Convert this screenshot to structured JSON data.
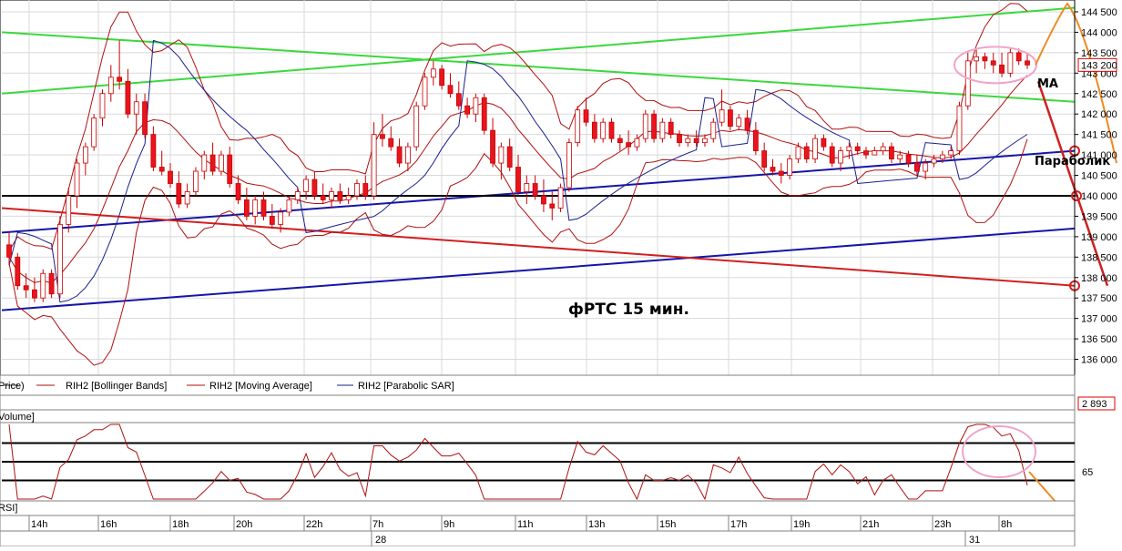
{
  "chart_data": {
    "type": "candlestick",
    "title": "фРТС   15 мин.",
    "symbol": "RIH2",
    "price_axis": {
      "ticks": [
        "144 500",
        "144 000",
        "143 500",
        "143 000",
        "142 500",
        "142 000",
        "141 500",
        "141 000",
        "140 500",
        "140 000",
        "139 500",
        "139 000",
        "138 500",
        "138 000",
        "137 500",
        "137 000",
        "136 500",
        "136 000"
      ],
      "values": [
        144500,
        144000,
        143500,
        143000,
        142500,
        142000,
        141500,
        141000,
        140500,
        140000,
        139500,
        139000,
        138500,
        138000,
        137500,
        137000,
        136500,
        136000
      ],
      "range": [
        135700,
        144700
      ],
      "last_price": "143 200"
    },
    "legend": {
      "price": "Price)",
      "bollinger": "RIH2 [Bollinger Bands]",
      "ma": "RIH2 [Moving Average]",
      "psar": "RIH2 [Parabolic SAR]"
    },
    "volume_panel": {
      "label": "Volume]",
      "value": "2 893"
    },
    "rsi_panel": {
      "label": "RSI]",
      "level_label": "65",
      "levels": [
        80,
        65,
        50
      ]
    },
    "time_axis": {
      "hour_labels": [
        "14h",
        "16h",
        "18h",
        "20h",
        "22h",
        "7h",
        "9h",
        "11h",
        "13h",
        "15h",
        "17h",
        "19h",
        "21h",
        "23h",
        "8h"
      ],
      "day_labels": [
        "28",
        "31"
      ]
    },
    "annotations": {
      "ma": "MA",
      "parabolic": "Параболик"
    },
    "candles": [
      [
        138800,
        139100,
        138300,
        138500
      ],
      [
        138500,
        138600,
        137700,
        137800
      ],
      [
        137800,
        138100,
        137500,
        137700
      ],
      [
        137700,
        138000,
        137400,
        137500
      ],
      [
        137500,
        138200,
        137400,
        138100
      ],
      [
        138100,
        138200,
        137500,
        137600
      ],
      [
        137600,
        139500,
        137500,
        139300
      ],
      [
        139300,
        140200,
        139100,
        140000
      ],
      [
        140000,
        140900,
        139700,
        140800
      ],
      [
        140800,
        141300,
        140500,
        141200
      ],
      [
        141200,
        142000,
        141100,
        141900
      ],
      [
        141900,
        142600,
        141700,
        142500
      ],
      [
        142500,
        143200,
        142300,
        142900
      ],
      [
        142900,
        143800,
        142600,
        142800
      ],
      [
        142800,
        143100,
        141900,
        142000
      ],
      [
        142000,
        142500,
        141500,
        142300
      ],
      [
        142300,
        142500,
        141400,
        141500
      ],
      [
        141500,
        141700,
        140600,
        140700
      ],
      [
        140700,
        141100,
        140500,
        140600
      ],
      [
        140600,
        140800,
        140200,
        140300
      ],
      [
        140300,
        140600,
        139700,
        139800
      ],
      [
        139800,
        140300,
        139700,
        140100
      ],
      [
        140100,
        140700,
        140000,
        140600
      ],
      [
        140600,
        141100,
        140400,
        141000
      ],
      [
        141000,
        141300,
        140500,
        140600
      ],
      [
        140600,
        141100,
        140500,
        141000
      ],
      [
        141000,
        141200,
        140200,
        140300
      ],
      [
        140300,
        140500,
        139800,
        139900
      ],
      [
        139900,
        140200,
        139400,
        139500
      ],
      [
        139500,
        140000,
        139300,
        139900
      ],
      [
        139900,
        140100,
        139400,
        139500
      ],
      [
        139500,
        139800,
        139200,
        139300
      ],
      [
        139300,
        139700,
        139100,
        139600
      ],
      [
        139600,
        140000,
        139500,
        139900
      ],
      [
        139900,
        140200,
        139800,
        140100
      ],
      [
        140100,
        140500,
        139900,
        140400
      ],
      [
        140400,
        140600,
        139900,
        140000
      ],
      [
        140000,
        140300,
        139800,
        139900
      ],
      [
        139900,
        140200,
        139700,
        140100
      ],
      [
        140100,
        140300,
        139800,
        139900
      ],
      [
        139900,
        140200,
        139800,
        140000
      ],
      [
        140000,
        140400,
        139900,
        140300
      ],
      [
        140300,
        140500,
        139900,
        140000
      ],
      [
        140000,
        141800,
        139900,
        141500
      ],
      [
        141500,
        142000,
        141200,
        141400
      ],
      [
        141400,
        141700,
        141100,
        141200
      ],
      [
        141200,
        141400,
        140700,
        140800
      ],
      [
        140800,
        141300,
        140600,
        141200
      ],
      [
        141200,
        142300,
        141100,
        142200
      ],
      [
        142200,
        143000,
        142100,
        142900
      ],
      [
        142900,
        143300,
        142700,
        143100
      ],
      [
        143100,
        143200,
        142600,
        142700
      ],
      [
        142700,
        143000,
        142400,
        142500
      ],
      [
        142500,
        142800,
        142100,
        142200
      ],
      [
        142200,
        142400,
        141900,
        142000
      ],
      [
        142000,
        142500,
        141800,
        142400
      ],
      [
        142400,
        142500,
        141500,
        141600
      ],
      [
        141600,
        141900,
        140700,
        140800
      ],
      [
        140800,
        141300,
        140400,
        141200
      ],
      [
        141200,
        141400,
        140600,
        140700
      ],
      [
        140700,
        141000,
        140000,
        140100
      ],
      [
        140100,
        140500,
        139800,
        140300
      ],
      [
        140300,
        140500,
        139900,
        140000
      ],
      [
        140000,
        140400,
        139600,
        139800
      ],
      [
        139800,
        140100,
        139400,
        139700
      ],
      [
        139700,
        140300,
        139600,
        140200
      ],
      [
        140200,
        141400,
        140100,
        141300
      ],
      [
        141300,
        142200,
        141200,
        142100
      ],
      [
        142100,
        142400,
        141700,
        141800
      ],
      [
        141800,
        142000,
        141300,
        141400
      ],
      [
        141400,
        141900,
        141300,
        141800
      ],
      [
        141800,
        141900,
        141300,
        141400
      ],
      [
        141400,
        141500,
        141100,
        141300
      ],
      [
        141300,
        141600,
        141000,
        141200
      ],
      [
        141200,
        141500,
        141100,
        141400
      ],
      [
        141400,
        142100,
        141300,
        142000
      ],
      [
        142000,
        142100,
        141300,
        141400
      ],
      [
        141400,
        141900,
        141300,
        141800
      ],
      [
        141800,
        141900,
        141400,
        141500
      ],
      [
        141500,
        141600,
        141200,
        141300
      ],
      [
        141300,
        141500,
        141200,
        141400
      ],
      [
        141400,
        141600,
        141200,
        141300
      ],
      [
        141300,
        141500,
        141200,
        141400
      ],
      [
        141400,
        141900,
        141300,
        141800
      ],
      [
        141800,
        142600,
        141700,
        142100
      ],
      [
        142100,
        142200,
        141600,
        141700
      ],
      [
        141700,
        142000,
        141600,
        141900
      ],
      [
        141900,
        142100,
        141500,
        141600
      ],
      [
        141600,
        141800,
        141000,
        141100
      ],
      [
        141100,
        141300,
        140600,
        140700
      ],
      [
        140700,
        140900,
        140500,
        140600
      ],
      [
        140600,
        140800,
        140300,
        140500
      ],
      [
        140500,
        141000,
        140400,
        140900
      ],
      [
        140900,
        141300,
        140800,
        141200
      ],
      [
        141200,
        141300,
        140800,
        140900
      ],
      [
        140900,
        141500,
        140800,
        141400
      ],
      [
        141400,
        141500,
        141100,
        141200
      ],
      [
        141200,
        141300,
        140700,
        140800
      ],
      [
        140800,
        141200,
        140600,
        141100
      ],
      [
        141100,
        141300,
        140900,
        141200
      ],
      [
        141200,
        141300,
        141000,
        141100
      ],
      [
        141100,
        141200,
        140900,
        141000
      ],
      [
        141000,
        141200,
        141000,
        141100
      ],
      [
        141100,
        141300,
        141000,
        141200
      ],
      [
        141200,
        141300,
        140800,
        140900
      ],
      [
        140900,
        141100,
        140800,
        141000
      ],
      [
        141000,
        141100,
        140700,
        140800
      ],
      [
        140800,
        141000,
        140500,
        140600
      ],
      [
        140600,
        140900,
        140400,
        140800
      ],
      [
        140800,
        141000,
        140700,
        140900
      ],
      [
        140900,
        141100,
        140800,
        141000
      ],
      [
        141000,
        141200,
        140900,
        141100
      ],
      [
        141100,
        142300,
        141000,
        142200
      ],
      [
        142200,
        143500,
        142100,
        143300
      ],
      [
        143300,
        143600,
        143000,
        143400
      ],
      [
        143400,
        143500,
        143100,
        143300
      ],
      [
        143300,
        143500,
        143000,
        143200
      ],
      [
        143200,
        143500,
        142900,
        143000
      ],
      [
        143000,
        143600,
        142900,
        143500
      ],
      [
        143500,
        143600,
        143200,
        143300
      ],
      [
        143300,
        143500,
        143100,
        143200
      ]
    ]
  },
  "colors": {
    "up_candle": "#ffffff",
    "down_candle": "#e8141e",
    "candle_outline": "#c80000",
    "bollinger": "#b01010",
    "moving_average": "#b01010",
    "parabolic_sar": "#1b1f8c",
    "green_lines": "#3cd83c",
    "blue_lines": "#1515a6",
    "red_line": "#d02020",
    "forecast": "#f08a20",
    "grid": "#d9d9d9",
    "highlight_ellipse": "#f0a4c8"
  }
}
